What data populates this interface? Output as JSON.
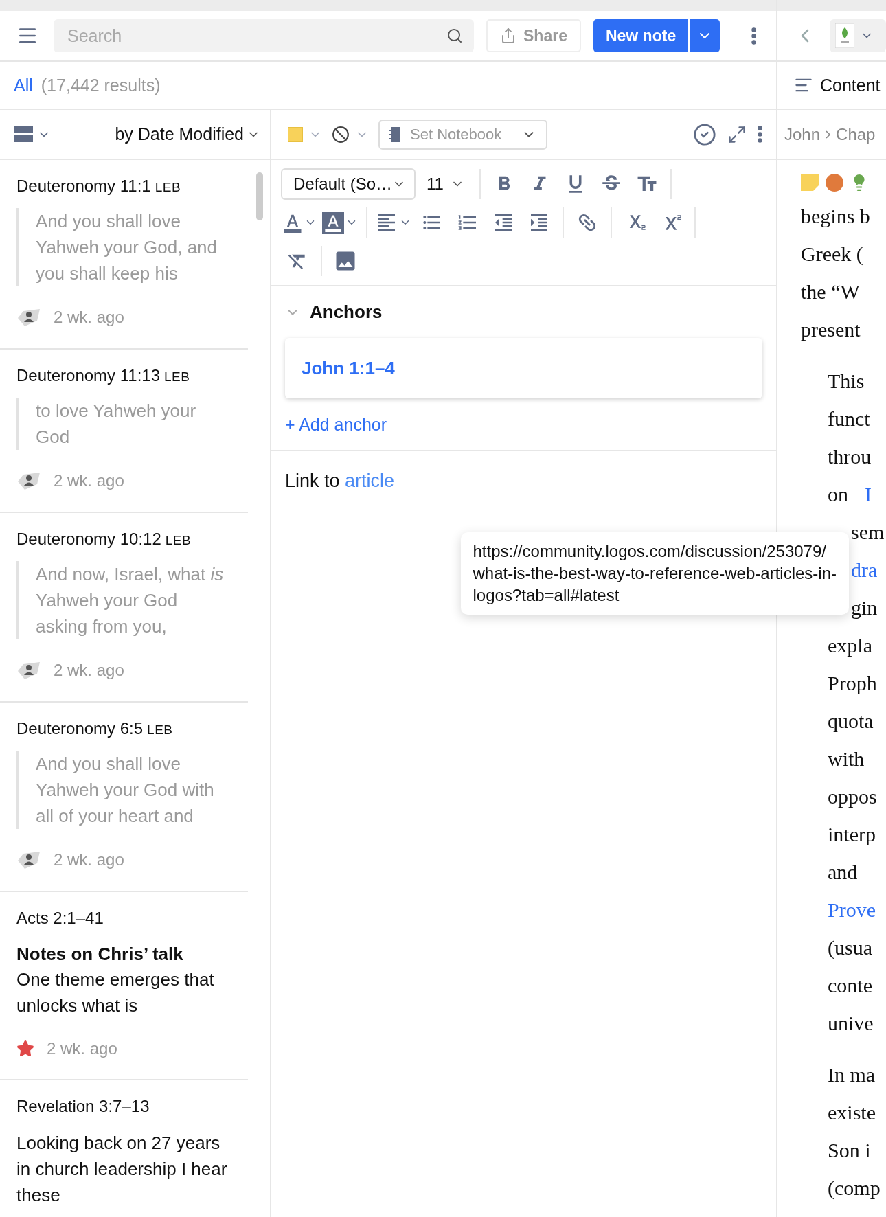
{
  "header": {
    "search": {
      "placeholder": "Search"
    },
    "share": "Share",
    "new_note": "New note"
  },
  "filter": {
    "scope": "All",
    "count": "(17,442 results)"
  },
  "list_header": {
    "sort": "by Date Modified"
  },
  "notes": [
    {
      "kind": "verse",
      "reference": "Deuteronomy 11:1",
      "version": "LEB",
      "quote": "And you shall love Yahweh your God, and you shall keep his",
      "time": "2 wk. ago"
    },
    {
      "kind": "verse",
      "reference": "Deuteronomy 11:13",
      "version": "LEB",
      "quote": "to love Yahweh your God",
      "time": "2 wk. ago"
    },
    {
      "kind": "verse",
      "reference": "Deuteronomy 10:12",
      "version": "LEB",
      "quote": "And now, Israel, what *is* Yahweh your God asking from you,",
      "time": "2 wk. ago"
    },
    {
      "kind": "verse",
      "reference": "Deuteronomy 6:5",
      "version": "LEB",
      "quote": "And you shall love Yahweh your God with all of your heart and",
      "time": "2 wk. ago"
    },
    {
      "kind": "starred",
      "reference": "Acts 2:1–41",
      "title": "Notes on Chris’ talk",
      "body": "One theme emerges that unlocks what is",
      "time": "2 wk. ago"
    },
    {
      "kind": "note",
      "reference": "Revelation 3:7–13",
      "body": "Looking back on 27 years in church leadership I hear these"
    }
  ],
  "note_toolbar": {
    "notebook_placeholder": "Set Notebook"
  },
  "format_toolbar": {
    "font": "Default (So…",
    "size": "11"
  },
  "anchors": {
    "title": "Anchors",
    "expanded": true,
    "items": [
      "John 1:1–4"
    ],
    "add": "+ Add anchor"
  },
  "body": {
    "text": "Link to",
    "link": "article"
  },
  "tooltip": {
    "lines": [
      "https://community.logos.com/discussion/253079/",
      "what-is-the-best-way-to-reference-web-articles-in-",
      "logos?tab=all#latest"
    ]
  },
  "reader": {
    "tab": "Content",
    "breadcrumb": [
      "John",
      "Chap"
    ],
    "paragraphs": [
      {
        "indented": false,
        "lines": [
          {
            "text": "begins b"
          },
          {
            "text": "Greek ("
          },
          {
            "text": "the “W"
          },
          {
            "text": "present"
          }
        ]
      },
      {
        "indented": true,
        "lines": [
          {
            "text": "This"
          },
          {
            "text": "funct"
          },
          {
            "text": "throu"
          },
          {
            "text": "on",
            "link": "I"
          },
          {
            "text": "sem",
            "covered": true
          },
          {
            "link": "dra",
            "covered": true
          },
          {
            "text": "gin",
            "covered": true
          },
          {
            "text": "expla"
          },
          {
            "text": "Proph"
          },
          {
            "text": "quota"
          },
          {
            "text": "with"
          },
          {
            "text": "oppos"
          },
          {
            "text": "interp"
          },
          {
            "text": "and"
          },
          {
            "link": "Prove"
          },
          {
            "text": "(usua"
          },
          {
            "text": "conte"
          },
          {
            "text": "unive"
          }
        ]
      },
      {
        "indented": true,
        "lines": [
          {
            "text": "In ma"
          },
          {
            "text": "existe"
          },
          {
            "text": "Son i"
          },
          {
            "text": "(comp"
          }
        ]
      }
    ]
  }
}
